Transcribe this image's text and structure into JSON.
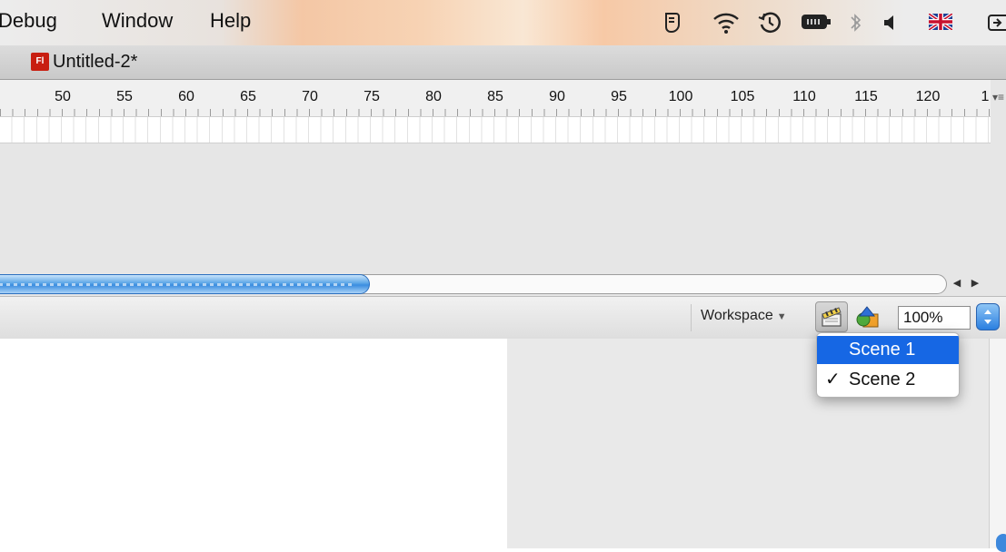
{
  "menubar": {
    "items": [
      "Debug",
      "Window",
      "Help"
    ],
    "status_icons": [
      "scripts-icon",
      "wifi-icon",
      "time-machine-icon",
      "battery-icon",
      "bluetooth-icon",
      "volume-icon",
      "uk-flag-icon",
      "input-menu-icon"
    ]
  },
  "document": {
    "title": "Untitled-2*",
    "icon_text": "Fl"
  },
  "timeline": {
    "ticks": [
      "50",
      "55",
      "60",
      "65",
      "70",
      "75",
      "80",
      "85",
      "90",
      "95",
      "100",
      "105",
      "110",
      "115",
      "120",
      "1"
    ]
  },
  "editbar": {
    "workspace_label": "Workspace",
    "zoom_value": "100%"
  },
  "scene_menu": {
    "items": [
      {
        "label": "Scene 1",
        "checked": false,
        "highlighted": true
      },
      {
        "label": "Scene 2",
        "checked": true,
        "highlighted": false
      }
    ],
    "check_glyph": "✓"
  },
  "colors": {
    "highlight": "#1667e4",
    "scroll_thumb": "#3a8de0",
    "doc_icon": "#c81e10"
  }
}
